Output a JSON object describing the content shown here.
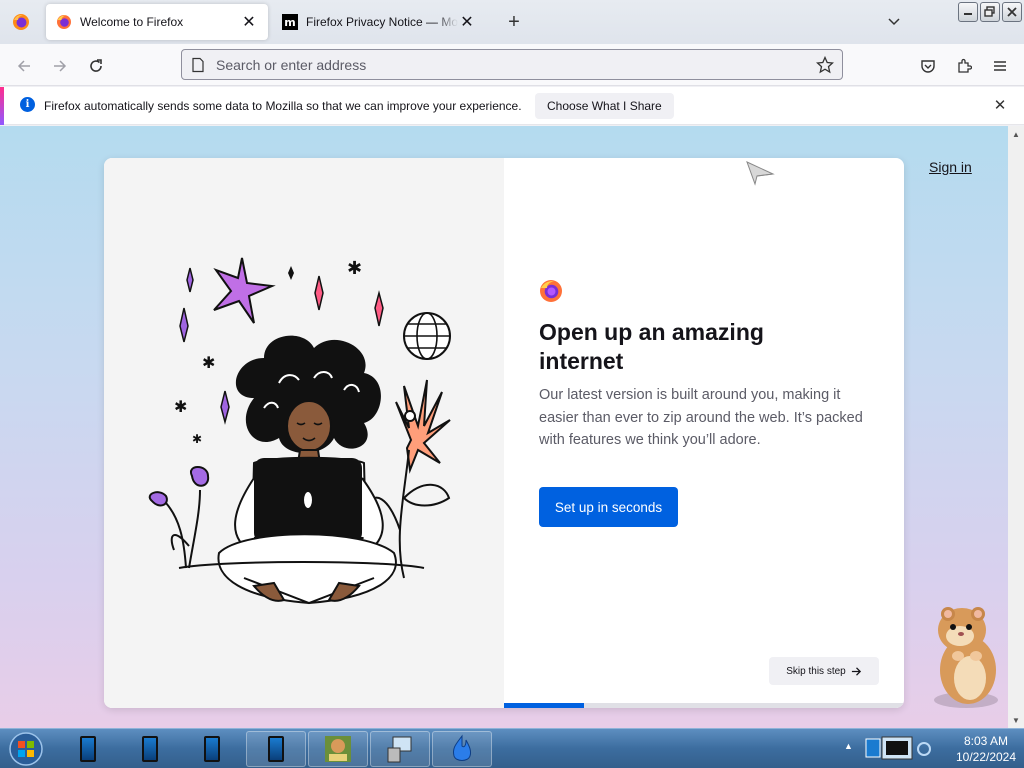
{
  "browser": {
    "tabs": [
      {
        "title": "Welcome to Firefox",
        "active": true
      },
      {
        "title": "Firefox Privacy Notice — Mozilla",
        "active": false
      }
    ],
    "urlbar": {
      "placeholder": "Search or enter address",
      "value": ""
    }
  },
  "notification": {
    "message": "Firefox automatically sends some data to Mozilla so that we can improve your experience.",
    "button_label": "Choose What I Share"
  },
  "page": {
    "sign_in_label": "Sign in",
    "heading": "Open up an amazing internet",
    "subtitle": "Our latest version is built around you, making it easier than ever to zip around the web. It’s packed with features we think you’ll adore.",
    "primary_button": "Set up in seconds",
    "skip_button": "Skip this step",
    "progress_fraction": 0.2
  },
  "taskbar": {
    "clock_time": "8:03 AM",
    "clock_date": "10/22/2024"
  },
  "colors": {
    "accent_blue": "#0061e0",
    "notification_accent": "#ff2d8e",
    "info_blue": "#0060df"
  },
  "icons": [
    "firefox-menu-icon",
    "firefox-favicon",
    "mozilla-favicon",
    "close-icon",
    "new-tab-icon",
    "list-all-tabs-icon",
    "back-icon",
    "forward-icon",
    "reload-icon",
    "page-icon",
    "bookmark-star-icon",
    "pocket-icon",
    "extensions-icon",
    "app-menu-icon",
    "info-icon",
    "arrow-right-icon",
    "windows-start-icon"
  ]
}
